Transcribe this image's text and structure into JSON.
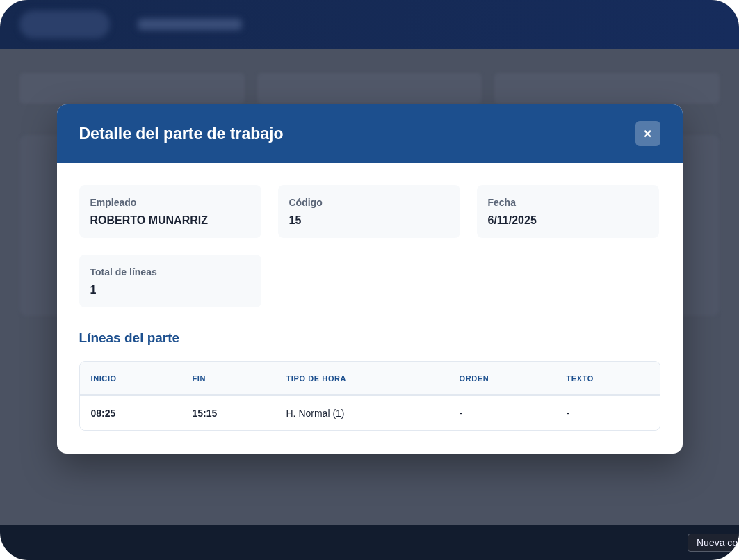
{
  "modal": {
    "title": "Detalle del parte de trabajo",
    "close_label": "×",
    "fields": [
      {
        "label": "Empleado",
        "value": "ROBERTO MUNARRIZ"
      },
      {
        "label": "Código",
        "value": "15"
      },
      {
        "label": "Fecha",
        "value": "6/11/2025"
      },
      {
        "label": "Total de líneas",
        "value": "1"
      }
    ],
    "section_title": "Líneas del parte",
    "table": {
      "columns": [
        "INICIO",
        "FIN",
        "TIPO DE HORA",
        "ORDEN",
        "TEXTO"
      ],
      "rows": [
        [
          "08:25",
          "15:15",
          "H. Normal (1)",
          "-",
          "-"
        ]
      ]
    }
  },
  "floating_button": {
    "label": "Nueva co"
  }
}
